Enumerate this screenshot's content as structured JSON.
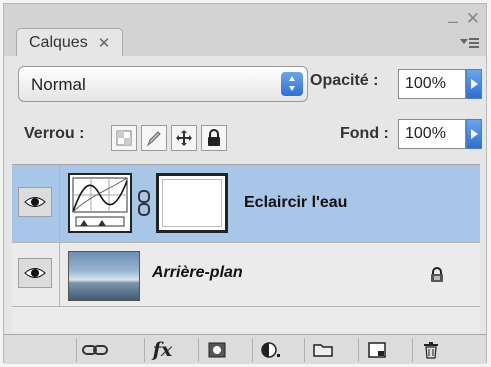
{
  "panel": {
    "tab_label": "Calques",
    "tab_close_glyph": "✕",
    "minimize_glyph": "–",
    "close_glyph": "✕"
  },
  "blend": {
    "mode_value": "Normal",
    "opacity_label": "Opacité :",
    "opacity_value": "100%"
  },
  "lock": {
    "label": "Verrou :",
    "icons": [
      "lock-transparent-pixels-icon",
      "lock-image-pixels-icon",
      "lock-position-icon",
      "lock-all-icon"
    ],
    "fill_label": "Fond :",
    "fill_value": "100%"
  },
  "layers": [
    {
      "name": "Eclaircir l'eau",
      "selected": true,
      "visible": true,
      "type": "adjustment"
    },
    {
      "name": "Arrière-plan",
      "selected": false,
      "visible": true,
      "type": "background",
      "locked": true
    }
  ],
  "footer": {
    "fx_label": "fx",
    "buttons": [
      "link-layers-icon",
      "layer-style-icon",
      "add-mask-icon",
      "adjustment-layer-icon",
      "new-group-icon",
      "new-layer-icon",
      "trash-icon"
    ]
  },
  "colors": {
    "selected_row": "#a8c6e8",
    "accent_blue": "#2e6fd0"
  }
}
